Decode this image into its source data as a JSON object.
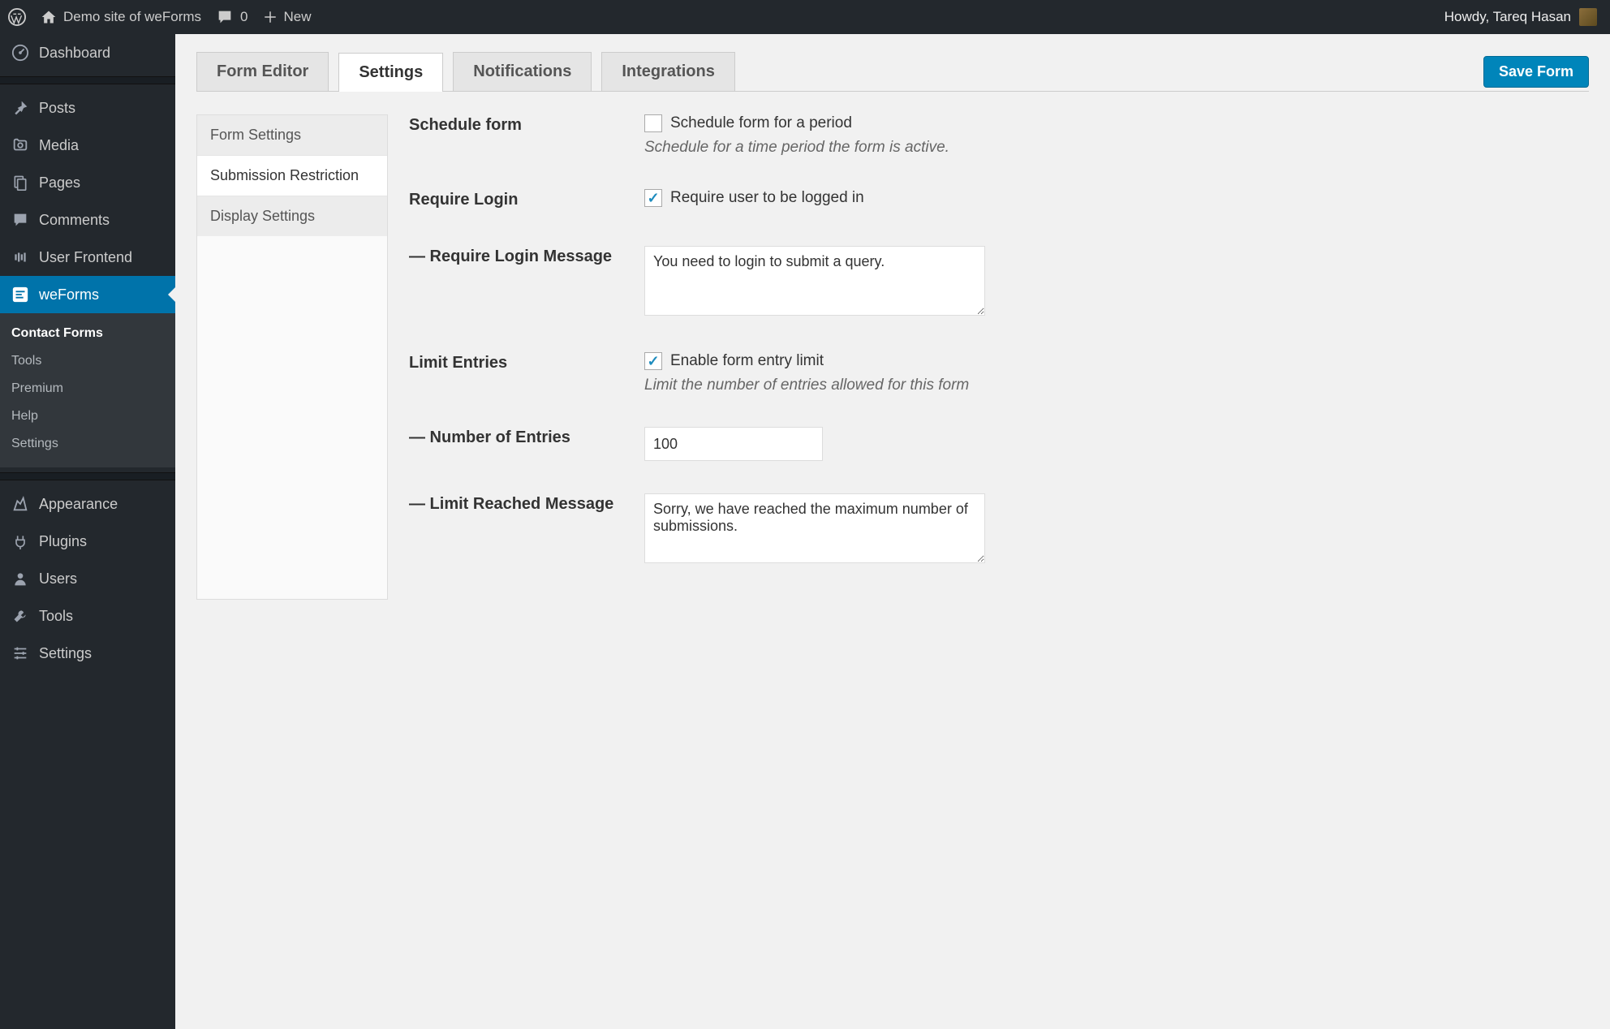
{
  "adminbar": {
    "site_name": "Demo site of weForms",
    "comments_count": "0",
    "new_label": "New",
    "greeting": "Howdy, Tareq Hasan"
  },
  "sidebar": {
    "items": [
      {
        "label": "Dashboard",
        "icon": "dashboard"
      },
      {
        "label": "Posts",
        "icon": "pin"
      },
      {
        "label": "Media",
        "icon": "media"
      },
      {
        "label": "Pages",
        "icon": "pages"
      },
      {
        "label": "Comments",
        "icon": "comments"
      },
      {
        "label": "User Frontend",
        "icon": "userfrontend"
      },
      {
        "label": "weForms",
        "icon": "weforms"
      }
    ],
    "weforms_submenu": [
      {
        "label": "Contact Forms"
      },
      {
        "label": "Tools"
      },
      {
        "label": "Premium"
      },
      {
        "label": "Help"
      },
      {
        "label": "Settings"
      }
    ],
    "items_bottom": [
      {
        "label": "Appearance",
        "icon": "appearance"
      },
      {
        "label": "Plugins",
        "icon": "plugins"
      },
      {
        "label": "Users",
        "icon": "users"
      },
      {
        "label": "Tools",
        "icon": "tools"
      },
      {
        "label": "Settings",
        "icon": "settings"
      }
    ]
  },
  "tabs": [
    {
      "label": "Form Editor"
    },
    {
      "label": "Settings"
    },
    {
      "label": "Notifications"
    },
    {
      "label": "Integrations"
    }
  ],
  "save_button": "Save Form",
  "settings_nav": [
    {
      "label": "Form Settings"
    },
    {
      "label": "Submission Restriction"
    },
    {
      "label": "Display Settings"
    }
  ],
  "form": {
    "schedule": {
      "label": "Schedule form",
      "checkbox_label": "Schedule form for a period",
      "help": "Schedule for a time period the form is active."
    },
    "require_login": {
      "label": "Require Login",
      "checkbox_label": "Require user to be logged in"
    },
    "require_login_message": {
      "label": "— Require Login Message",
      "value": "You need to login to submit a query."
    },
    "limit_entries": {
      "label": "Limit Entries",
      "checkbox_label": "Enable form entry limit",
      "help": "Limit the number of entries allowed for this form"
    },
    "number_entries": {
      "label": "— Number of Entries",
      "value": "100"
    },
    "limit_message": {
      "label": "— Limit Reached Message",
      "value": "Sorry, we have reached the maximum number of submissions."
    }
  }
}
